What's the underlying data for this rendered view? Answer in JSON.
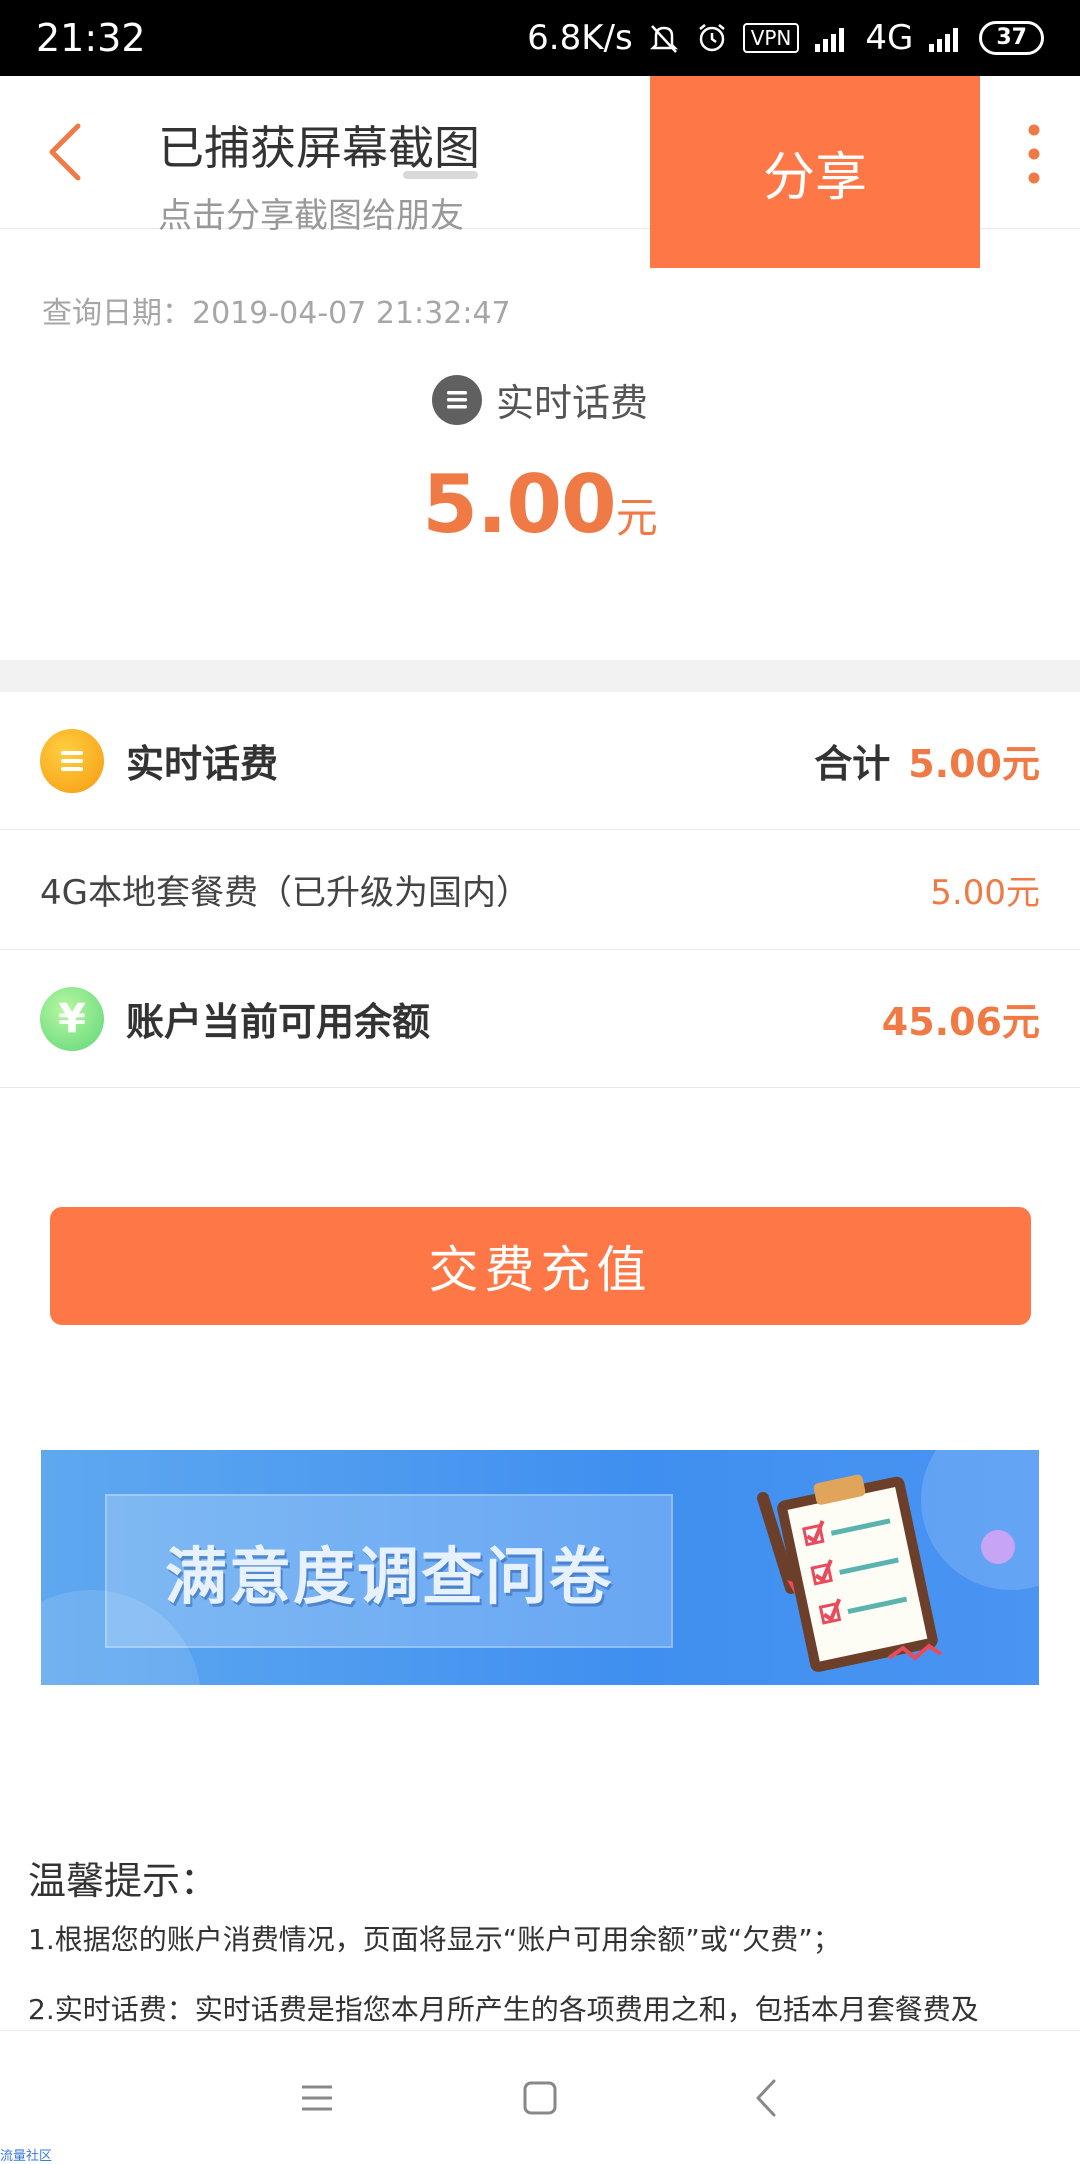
{
  "status_bar": {
    "time": "21:32",
    "speed": "6.8K/s",
    "vpn": "VPN",
    "network": "4G",
    "battery": "37"
  },
  "screenshot_popup": {
    "title": "已捕获屏幕截图",
    "subtitle": "点击分享截图给朋友",
    "share_label": "分享"
  },
  "summary": {
    "query_date": "查询日期：2019-04-07 21:32:47",
    "label": "实时话费",
    "amount": "5.00",
    "unit": "元"
  },
  "details": {
    "realtime_fee": {
      "title": "实时话费",
      "total_label": "合计",
      "total_value": "5.00元"
    },
    "plan_fee": {
      "name": "4G本地套餐费（已升级为国内）",
      "value": "5.00元"
    },
    "balance": {
      "icon_glyph": "¥",
      "title": "账户当前可用余额",
      "value": "45.06元"
    }
  },
  "pay_button": "交费充值",
  "banner": {
    "text": "满意度调查问卷"
  },
  "tips": {
    "title": "温馨提示：",
    "line1": "1.根据您的账户消费情况，页面将显示“账户可用余额”或“欠费”；",
    "line2": "2.实时话费：实时话费是指您本月所产生的各项费用之和，包括本月套餐费及"
  },
  "watermark": "流量社区",
  "colors": {
    "accent": "#fe7847",
    "amount": "#f07a46",
    "banner_blue": "#3f8ff0"
  }
}
